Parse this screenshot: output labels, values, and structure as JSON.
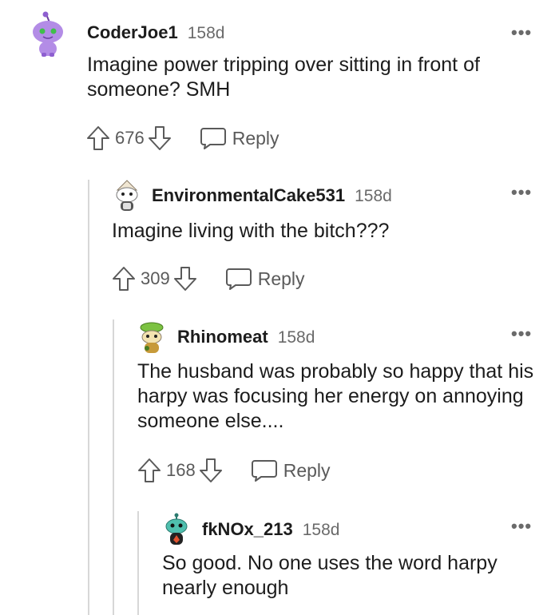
{
  "comments": [
    {
      "username": "CoderJoe1",
      "age": "158d",
      "body": "Imagine power tripping over sitting in front of someone? SMH",
      "votes": "676",
      "reply_label": "Reply",
      "more_label": "•••",
      "avatar_icon": "purple-alien-avatar"
    },
    {
      "username": "EnvironmentalCake531",
      "age": "158d",
      "body": "Imagine living with the bitch???",
      "votes": "309",
      "reply_label": "Reply",
      "more_label": "•••",
      "avatar_icon": "white-hat-avatar"
    },
    {
      "username": "Rhinomeat",
      "age": "158d",
      "body": "The husband was probably so happy that his harpy was focusing her energy on annoying someone else....",
      "votes": "168",
      "reply_label": "Reply",
      "more_label": "•••",
      "avatar_icon": "green-hat-avatar"
    },
    {
      "username": "fkNOx_213",
      "age": "158d",
      "body": "So good. No one uses the word harpy nearly enough",
      "more_label": "•••",
      "avatar_icon": "teal-alien-avatar"
    }
  ],
  "colors": {
    "text": "#1c1c1c",
    "muted": "#6a6a6a",
    "thread_line": "#d7d7d7"
  }
}
